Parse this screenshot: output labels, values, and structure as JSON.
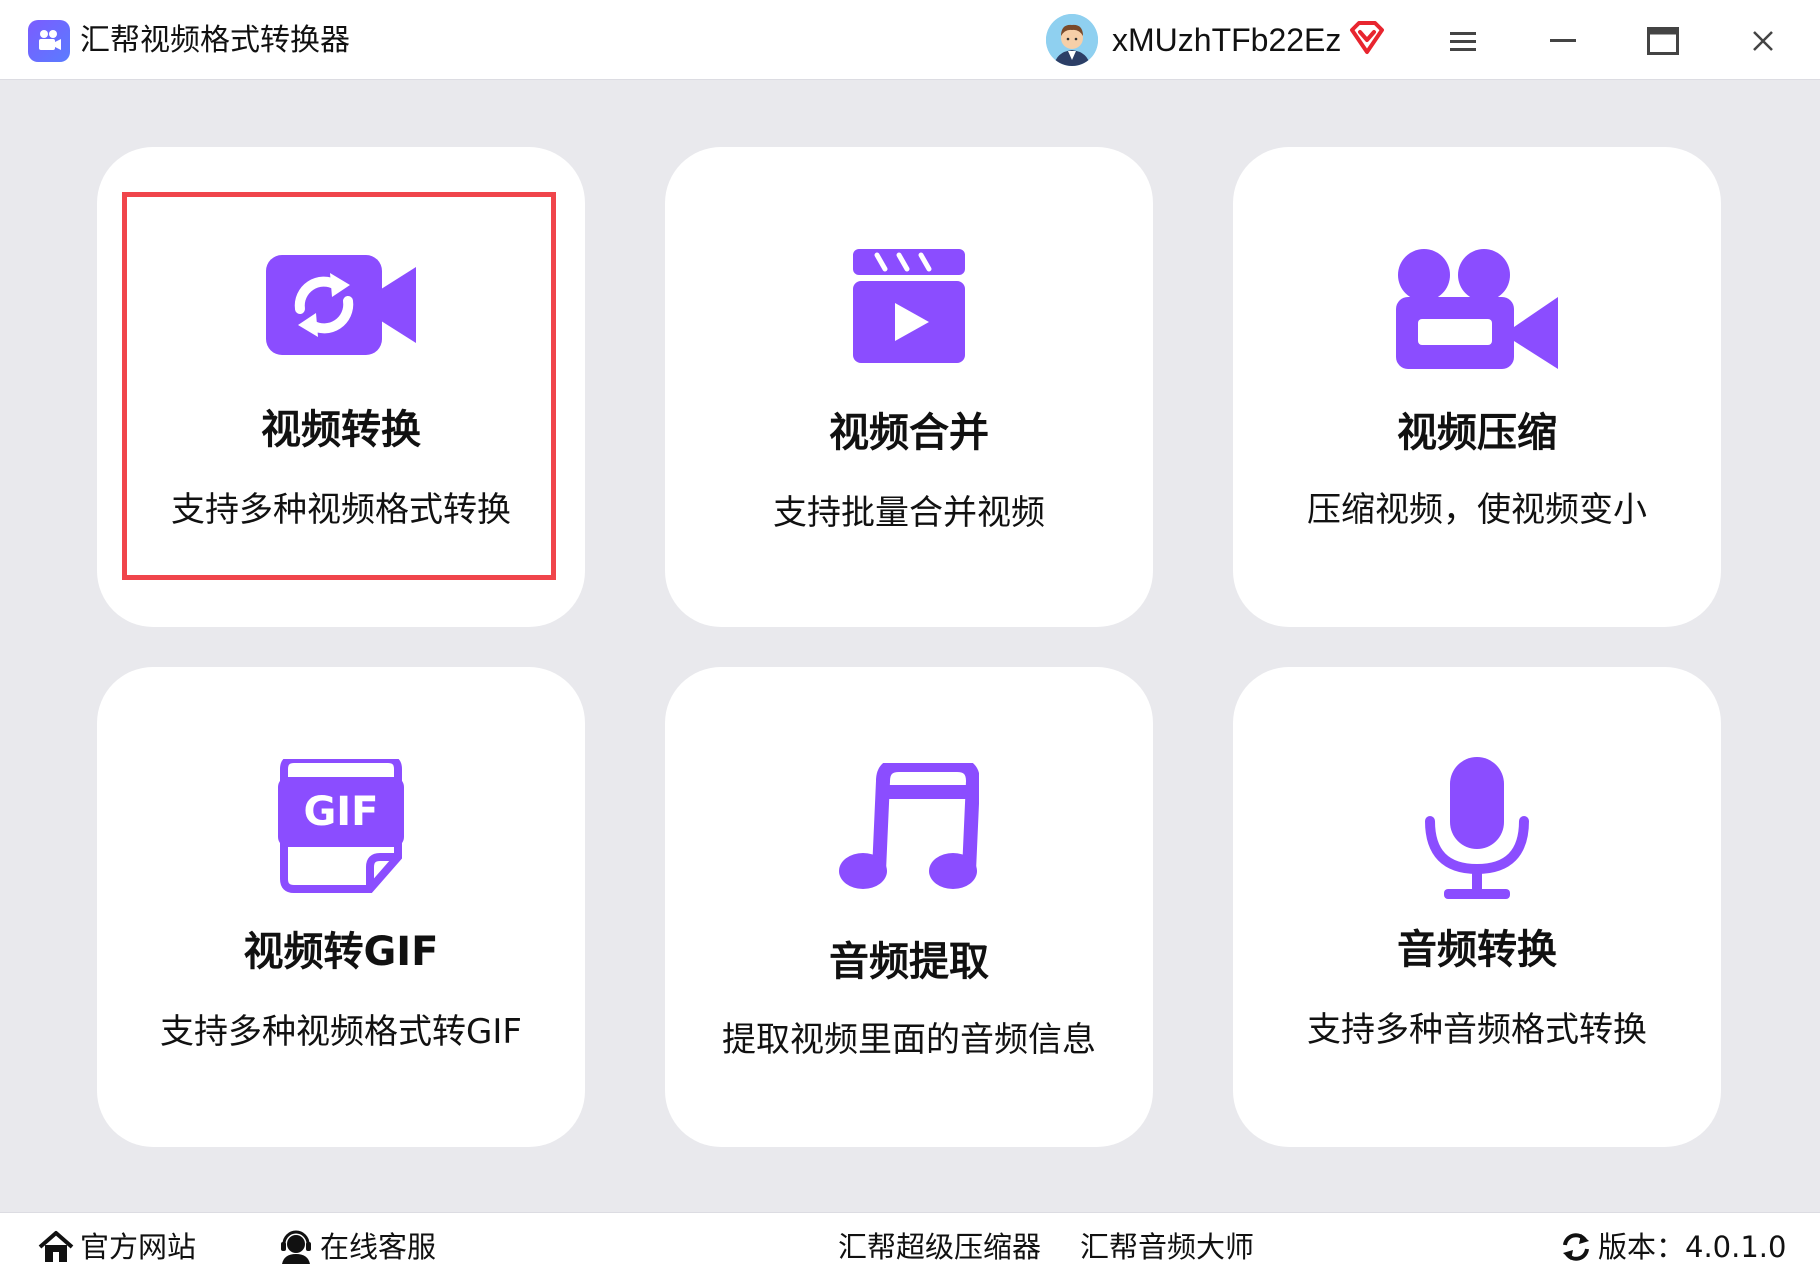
{
  "app": {
    "title": "汇帮视频格式转换器",
    "username": "xMUzhTFb22Ez"
  },
  "cards": [
    {
      "title": "视频转换",
      "desc": "支持多种视频格式转换",
      "icon": "video-convert-icon",
      "selected": true
    },
    {
      "title": "视频合并",
      "desc": "支持批量合并视频",
      "icon": "clapperboard-play-icon"
    },
    {
      "title": "视频压缩",
      "desc": "压缩视频，使视频变小",
      "icon": "video-camera-icon"
    },
    {
      "title": "视频转GIF",
      "desc": "支持多种视频格式转GIF",
      "icon": "gif-file-icon",
      "icon_text": "GIF"
    },
    {
      "title": "音频提取",
      "desc": "提取视频里面的音频信息",
      "icon": "music-note-icon"
    },
    {
      "title": "音频转换",
      "desc": "支持多种音频格式转换",
      "icon": "microphone-icon"
    }
  ],
  "footer": {
    "website": "官方网站",
    "service": "在线客服",
    "compressor": "汇帮超级压缩器",
    "audio_master": "汇帮音频大师",
    "version": "版本：4.0.1.0"
  },
  "colors": {
    "accent": "#8b4dff",
    "background": "#e9e9ed",
    "highlight": "#f0454b"
  }
}
